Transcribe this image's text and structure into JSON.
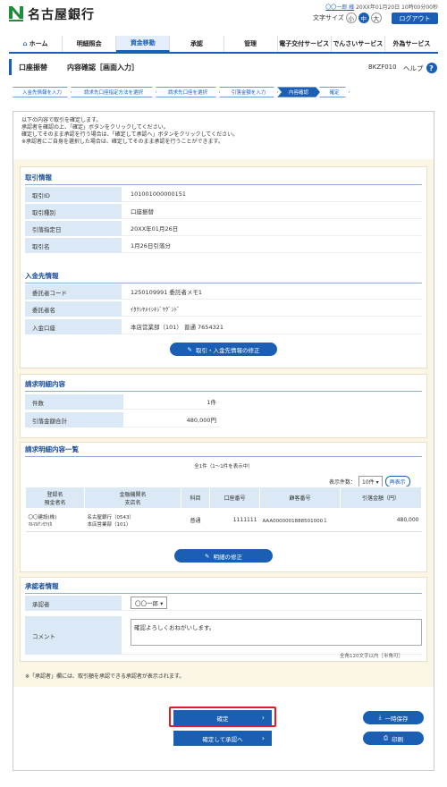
{
  "header": {
    "bank_name": "名古屋銀行",
    "user_name": "〇〇一郎 様",
    "last_login": "20XX年01月20日 10時00分00秒",
    "font_size_label": "文字サイズ",
    "font_sizes": [
      "小",
      "中",
      "大"
    ],
    "logout": "ログアウト"
  },
  "nav": [
    "ホーム",
    "明細照会",
    "資金移動",
    "承認",
    "管理",
    "電子交付サービス",
    "でんさいサービス",
    "外為サービス"
  ],
  "page": {
    "title": "口座振替",
    "subtitle": "内容確認［画面入力］",
    "code": "BKZF010",
    "help": "ヘルプ"
  },
  "steps": [
    "入金先情報を入力",
    "請求先口座指定方法を選択",
    "請求先口座を選択",
    "引落金額を入力",
    "内容確認",
    "確定"
  ],
  "intro": [
    "以下の内容で取引を確定します。",
    "承認者を確認の上、「確定」ボタンをクリックしてください。",
    "確定してそのまま承認を行う場合は、「確定して承認へ」ボタンをクリックしてください。",
    "※承認者にご自身を選択した場合は、確定してそのまま承認を行うことができます。"
  ],
  "transaction": {
    "heading": "取引情報",
    "rows": [
      {
        "k": "取引ID",
        "v": "101001000000151"
      },
      {
        "k": "取引種別",
        "v": "口座振替"
      },
      {
        "k": "引落指定日",
        "v": "20XX年01月26日"
      },
      {
        "k": "取引名",
        "v": "1月26日引落分"
      }
    ]
  },
  "payee": {
    "heading": "入金先情報",
    "rows": [
      {
        "k": "委託者コード",
        "v": "1250109991 委託者メモ1"
      },
      {
        "k": "委託者名",
        "v": "ｲﾀｸｼﾔﾒｲｼｷｼﾞﾔｸﾞﾝﾄﾞ"
      },
      {
        "k": "入金口座",
        "v": "本店営業部（101） 普通 7654321"
      }
    ],
    "edit_button": "取引・入金先情報の修正"
  },
  "billing": {
    "heading": "請求明細内容",
    "rows": [
      {
        "k": "件数",
        "v": "1件"
      },
      {
        "k": "引落金額合計",
        "v": "480,000円"
      }
    ]
  },
  "detail": {
    "heading": "請求明細内容一覧",
    "count": "全1件（1～1件を表示中）",
    "per_page_label": "表示件数：",
    "per_page": "10件",
    "redisplay": "再表示",
    "columns": [
      "登録名\n預金者名",
      "金融機関名\n支店名",
      "科目",
      "口座番号",
      "顧客番号",
      "引落金額（円）"
    ],
    "rows": [
      [
        "〇〇建設(株)\nﾏﾙﾏﾙｹﾝｾﾂ(ｶ",
        "名古屋銀行（0543）\n本店営業部（101）",
        "普通",
        "1111111",
        "AAA0000001888501000１",
        "480,000"
      ]
    ],
    "edit_button": "明細の修正"
  },
  "approver": {
    "heading": "承認者情報",
    "approver_label": "承認者",
    "approver_value": "〇〇一郎",
    "comment_label": "コメント",
    "comment_value": "確認よろしくおねがいします。",
    "char_limit": "全角120文字以内［半角可］",
    "note": "※「承認者」欄には、取引額を承認できる承認者が表示されます。"
  },
  "actions": {
    "confirm": "確定",
    "confirm_approve": "確定して承認へ",
    "temp_save": "一時保存",
    "print": "印刷"
  },
  "colors": {
    "accent": "#1a5fb4",
    "highlight": "#e01b24"
  }
}
